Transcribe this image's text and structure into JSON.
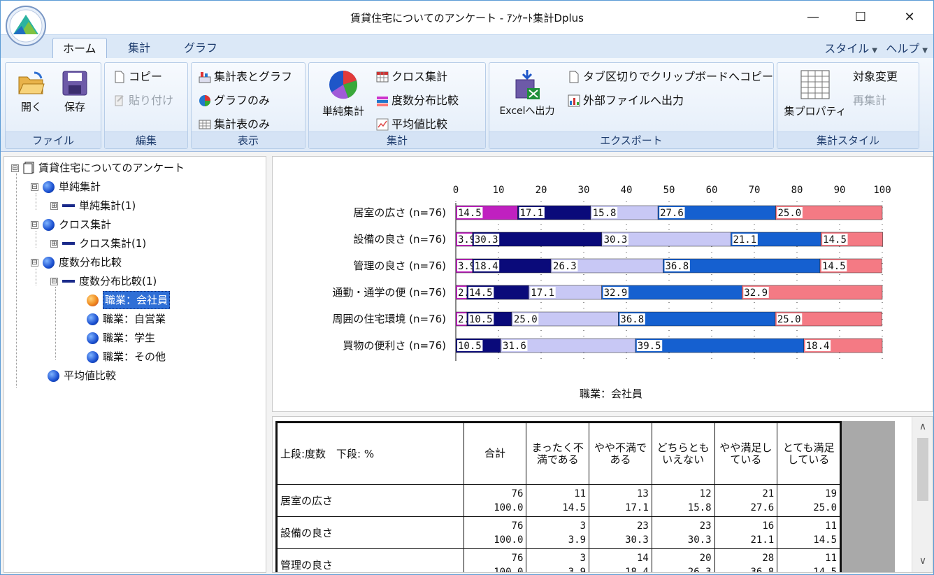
{
  "window": {
    "title": "賃貸住宅についてのアンケート - ｱﾝｹｰﾄ集計Dplus",
    "minimize": "—",
    "maximize": "☐",
    "close": "✕"
  },
  "ribbon": {
    "tabs": [
      "ホーム",
      "集計",
      "グラフ"
    ],
    "style_menu": "スタイル",
    "help_menu": "ヘルプ",
    "groups": {
      "file": {
        "label": "ファイル",
        "open": "開く",
        "save": "保存"
      },
      "edit": {
        "label": "編集",
        "copy": "コピー",
        "paste": "貼り付け"
      },
      "view": {
        "label": "表示",
        "table_and_graph": "集計表とグラフ",
        "graph_only": "グラフのみ",
        "table_only": "集計表のみ"
      },
      "aggregate": {
        "label": "集計",
        "simple": "単純集計",
        "cross": "クロス集計",
        "freq_compare": "度数分布比較",
        "mean_compare": "平均値比較"
      },
      "export": {
        "label": "エクスポート",
        "excel": "Excelへ出力",
        "tab_clipboard": "タブ区切りでクリップボードへコピー",
        "external_file": "外部ファイルへ出力"
      },
      "style": {
        "label": "集計スタイル",
        "properties": "集プロパティ",
        "change_target": "対象変更",
        "recalc": "再集計"
      }
    }
  },
  "tree": {
    "root": "賃貸住宅についてのアンケート",
    "simple": "単純集計",
    "simple_child": "単純集計(1)",
    "cross": "クロス集計",
    "cross_child": "クロス集計(1)",
    "freq": "度数分布比較",
    "freq_child": "度数分布比較(1)",
    "freq_items": [
      "職業：会社員",
      "職業：自営業",
      "職業：学生",
      "職業：その他"
    ],
    "mean": "平均値比較",
    "expand_glyph": "⊞",
    "collapse_glyph": "⊟"
  },
  "chart_data": {
    "type": "bar",
    "stacked": "100%",
    "orientation": "horizontal",
    "title": "職業：会社員",
    "categories": [
      "居室の広さ (n=76)",
      "設備の良さ (n=76)",
      "管理の良さ (n=76)",
      "通勤・通学の便 (n=76)",
      "周囲の住宅環境 (n=76)",
      "買物の便利さ (n=76)"
    ],
    "series": [
      {
        "name": "まったく不満である",
        "color": "#c020c0",
        "values": [
          0,
          0,
          0,
          0,
          0,
          0
        ]
      },
      {
        "name": "",
        "color": "#c020c0",
        "values": [
          14.5,
          3.9,
          3.9,
          2.6,
          2.6,
          0
        ]
      },
      {
        "name": "",
        "color": "#0a0a7a",
        "values": [
          17.1,
          30.3,
          18.4,
          14.5,
          10.5,
          10.5
        ]
      },
      {
        "name": "",
        "color": "#c8c8f5",
        "values": [
          15.8,
          30.3,
          26.3,
          17.1,
          25.0,
          31.6
        ]
      },
      {
        "name": "",
        "color": "#1560d0",
        "values": [
          27.6,
          21.1,
          36.8,
          32.9,
          36.8,
          39.5
        ]
      },
      {
        "name": "",
        "color": "#f47a84",
        "values": [
          25.0,
          14.5,
          14.5,
          32.9,
          25.0,
          18.4
        ]
      }
    ],
    "xlim": [
      0,
      100
    ],
    "xticks": [
      0,
      10,
      20,
      30,
      40,
      50,
      60,
      70,
      80,
      90,
      100
    ],
    "grid": true
  },
  "table": {
    "corner": "上段:度数　下段: %",
    "headers": [
      "合計",
      "まったく不満である",
      "やや不満である",
      "どちらともいえない",
      "やや満足している",
      "とても満足している"
    ],
    "rows": [
      {
        "label": "居室の広さ",
        "counts": [
          "76",
          "11",
          "13",
          "12",
          "21",
          "19"
        ],
        "pcts": [
          "100.0",
          "14.5",
          "17.1",
          "15.8",
          "27.6",
          "25.0"
        ]
      },
      {
        "label": "設備の良さ",
        "counts": [
          "76",
          "3",
          "23",
          "23",
          "16",
          "11"
        ],
        "pcts": [
          "100.0",
          "3.9",
          "30.3",
          "30.3",
          "21.1",
          "14.5"
        ]
      },
      {
        "label": "管理の良さ",
        "counts": [
          "76",
          "3",
          "14",
          "20",
          "28",
          "11"
        ],
        "pcts": [
          "100.0",
          "3.9",
          "18.4",
          "26.3",
          "36.8",
          "14.5"
        ]
      }
    ]
  },
  "scroll": {
    "up": "∧",
    "down": "∨"
  }
}
